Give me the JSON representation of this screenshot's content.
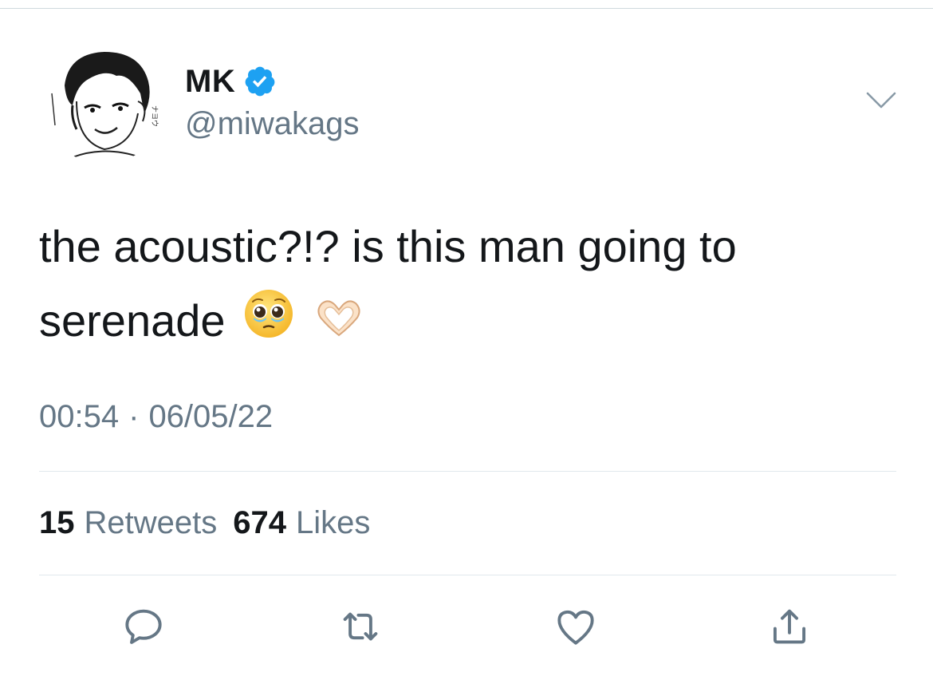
{
  "tweet": {
    "display_name": "MK",
    "handle": "@miwakags",
    "verified": true,
    "text_line1": "the acoustic?!? is this man going to",
    "text_line2": "serenade",
    "emojis": [
      "pleading-face",
      "heart-hands"
    ],
    "time": "00:54",
    "separator": "·",
    "date": "06/05/22"
  },
  "stats": {
    "retweets_count": "15",
    "retweets_label": "Retweets",
    "likes_count": "674",
    "likes_label": "Likes"
  },
  "actions": [
    "reply-icon",
    "retweet-icon",
    "like-icon",
    "share-icon"
  ],
  "colors": {
    "text": "#14171a",
    "secondary": "#657786",
    "verified": "#1da1f2",
    "divider": "#e1e8ed"
  }
}
